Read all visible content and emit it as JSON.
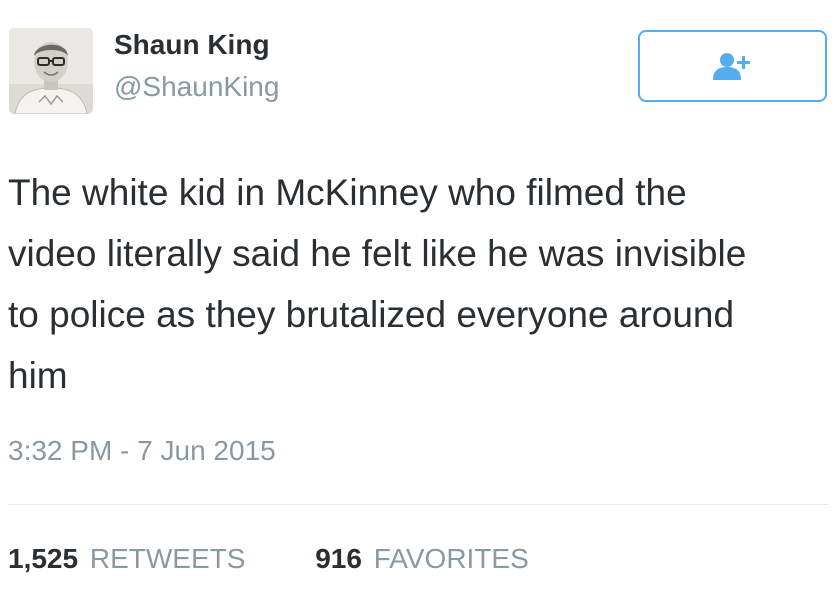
{
  "author": {
    "display_name": "Shaun King",
    "handle": "@ShaunKing",
    "avatar_icon": "profile-photo"
  },
  "follow_button": {
    "icon": "add-user-icon",
    "accent_color": "#55acee"
  },
  "tweet": {
    "text_lines": [
      "The white kid in McKinney who filmed the",
      "video literally said he felt like he was invisible",
      "to police as they brutalized everyone around",
      "him"
    ],
    "timestamp": "3:32 PM - 7 Jun 2015"
  },
  "stats": {
    "retweets": {
      "count": "1,525",
      "label": "RETWEETS"
    },
    "favorites": {
      "count": "916",
      "label": "FAVORITES"
    }
  },
  "colors": {
    "primary_text": "#292f33",
    "secondary_text": "#8899a6",
    "divider": "#e1e8ed"
  }
}
